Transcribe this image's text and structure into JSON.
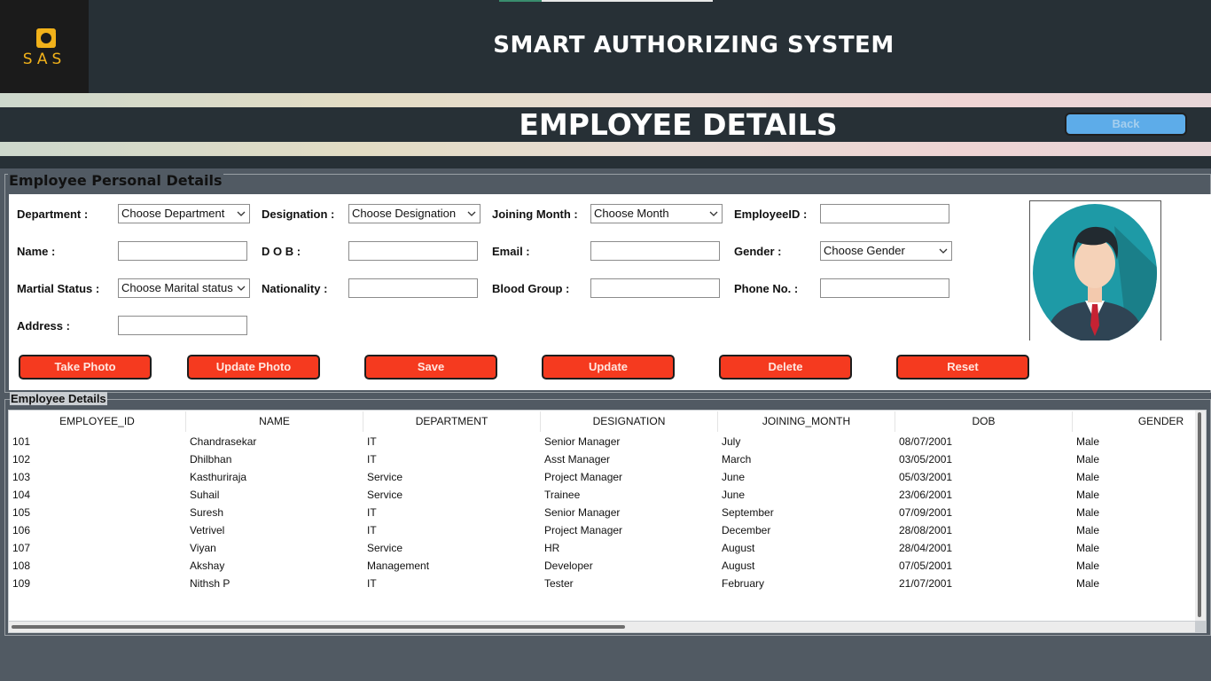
{
  "header": {
    "logo_text": "SAS",
    "app_title": "SMART AUTHORIZING SYSTEM"
  },
  "page": {
    "title": "EMPLOYEE DETAILS",
    "back_label": "Back"
  },
  "personal_section": {
    "legend": "Employee Personal Details",
    "labels": {
      "department": "Department :",
      "designation": "Designation :",
      "joining_month": "Joining Month :",
      "employee_id": "EmployeeID :",
      "name": "Name :",
      "dob": "D O B :",
      "email": "Email :",
      "gender": "Gender :",
      "marital_status": "Martial Status :",
      "nationality": "Nationality :",
      "blood_group": "Blood Group :",
      "phone": "Phone No. :",
      "address": "Address :"
    },
    "selects": {
      "department": "Choose Department",
      "designation": "Choose Designation",
      "joining_month": "Choose Month",
      "gender": "Choose Gender",
      "marital_status": "Choose Marital status"
    },
    "inputs": {
      "employee_id": "",
      "name": "",
      "dob": "",
      "email": "",
      "nationality": "",
      "blood_group": "",
      "phone": "",
      "address": ""
    },
    "buttons": {
      "take_photo": "Take Photo",
      "update_photo": "Update Photo",
      "save": "Save",
      "update": "Update",
      "delete": "Delete",
      "reset": "Reset"
    }
  },
  "table_section": {
    "legend": "Employee Details",
    "columns": [
      "EMPLOYEE_ID",
      "NAME",
      "DEPARTMENT",
      "DESIGNATION",
      "JOINING_MONTH",
      "DOB",
      "GENDER"
    ],
    "rows": [
      [
        "101",
        "Chandrasekar",
        "IT",
        "Senior Manager",
        "July",
        "08/07/2001",
        "Male"
      ],
      [
        "102",
        "Dhilbhan",
        "IT",
        "Asst Manager",
        "March",
        "03/05/2001",
        "Male"
      ],
      [
        "103",
        "Kasthuriraja",
        "Service",
        "Project Manager",
        "June",
        "05/03/2001",
        "Male"
      ],
      [
        "104",
        "Suhail",
        "Service",
        "Trainee",
        "June",
        "23/06/2001",
        "Male"
      ],
      [
        "105",
        "Suresh",
        "IT",
        "Senior Manager",
        "September",
        "07/09/2001",
        "Male"
      ],
      [
        "106",
        "Vetrivel",
        "IT",
        "Project Manager",
        "December",
        "28/08/2001",
        "Male"
      ],
      [
        "107",
        "Viyan",
        "Service",
        "HR",
        "August",
        "28/04/2001",
        "Male"
      ],
      [
        "108",
        "Akshay",
        "Management",
        "Developer",
        "August",
        "07/05/2001",
        "Male"
      ],
      [
        "109",
        "Nithsh P",
        "IT",
        "Tester",
        "February",
        "21/07/2001",
        "Male"
      ]
    ]
  },
  "icons": {
    "logo": "logo-icon",
    "avatar": "user-avatar-icon",
    "dropdown": "chevron-down-icon"
  },
  "colors": {
    "header_bg": "#273036",
    "accent_button": "#f53a1f",
    "back_button": "#5dace9",
    "logo": "#f2b21a"
  }
}
